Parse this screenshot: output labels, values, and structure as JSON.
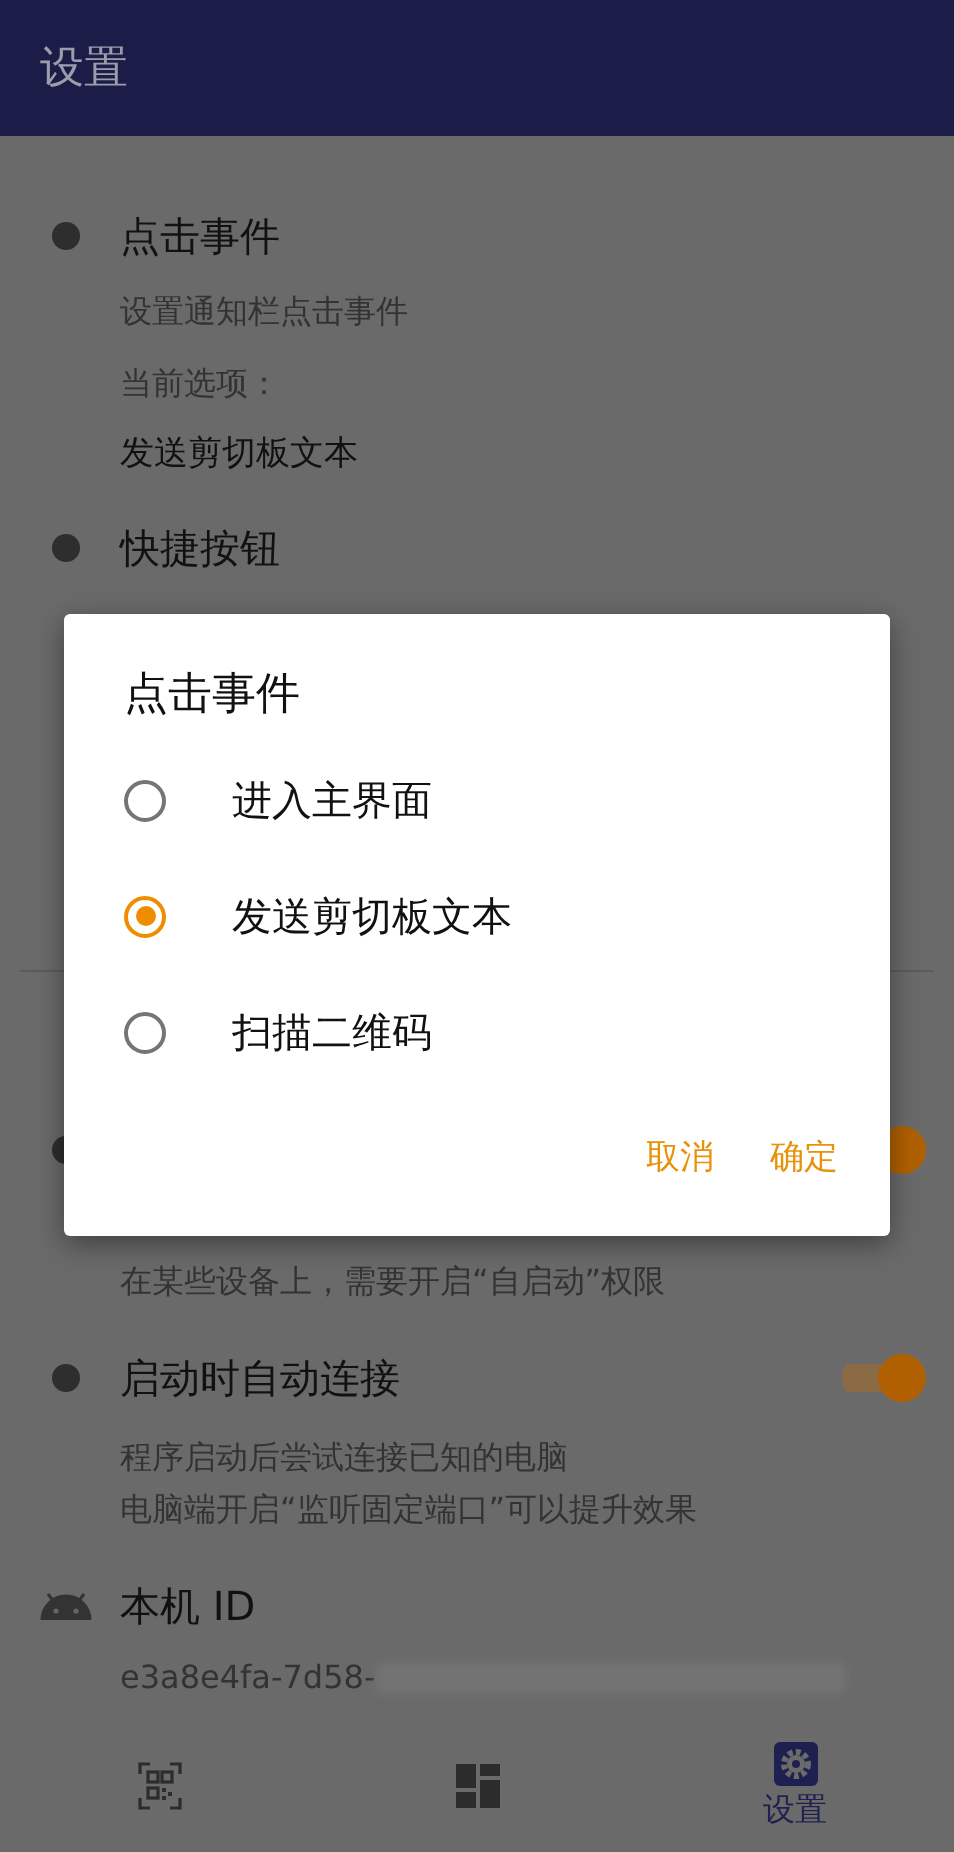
{
  "app_bar": {
    "title": "设置"
  },
  "click_event": {
    "title": "点击事件",
    "subtitle": "设置通知栏点击事件",
    "caption": "当前选项：",
    "value": "发送剪切板文本"
  },
  "shortcut": {
    "title": "快捷按钮"
  },
  "autostart": {
    "on": true,
    "note": "在某些设备上，需要开启“自启动”权限"
  },
  "auto_connect": {
    "title": "启动时自动连接",
    "on": true,
    "lines": [
      "程序启动后尝试连接已知的电脑",
      "电脑端开启“监听固定端口”可以提升效果"
    ]
  },
  "device_id": {
    "title": "本机 ID",
    "value": "e3a8e4fa-7d58-"
  },
  "dialog": {
    "title": "点击事件",
    "options": [
      {
        "label": "进入主界面",
        "selected": false
      },
      {
        "label": "发送剪切板文本",
        "selected": true
      },
      {
        "label": "扫描二维码",
        "selected": false
      }
    ],
    "buttons": [
      "取消",
      "确定"
    ]
  },
  "bottom_nav": [
    {
      "kind": "scan",
      "selected": false
    },
    {
      "kind": "dashboard",
      "selected": false
    },
    {
      "kind": "settings",
      "label": "设置",
      "selected": true
    }
  ]
}
